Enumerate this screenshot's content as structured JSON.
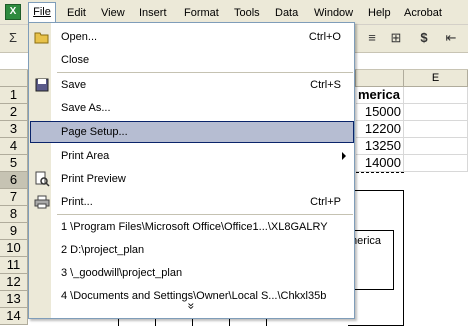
{
  "menubar": {
    "app_icon": "excel-icon",
    "items": [
      {
        "label": "File"
      },
      {
        "label": "Edit"
      },
      {
        "label": "View"
      },
      {
        "label": "Insert"
      },
      {
        "label": "Format"
      },
      {
        "label": "Tools"
      },
      {
        "label": "Data"
      },
      {
        "label": "Window"
      },
      {
        "label": "Help"
      },
      {
        "label": "Acrobat"
      }
    ]
  },
  "toolbar": {
    "sum_glyph": "Σ",
    "align_glyph": "≡",
    "merge_glyph": "⊞",
    "currency_glyph": "$",
    "indent_glyph": "⇤"
  },
  "sheet": {
    "col_e": "E",
    "rows": [
      "1",
      "2",
      "3",
      "4",
      "5",
      "6",
      "7",
      "8",
      "9",
      "10",
      "11",
      "12",
      "13",
      "14"
    ],
    "header_text": "merica",
    "values": [
      "15000",
      "12200",
      "13250",
      "14000"
    ],
    "legend_text": "merica"
  },
  "file_menu": {
    "items": [
      {
        "label": "Open...",
        "shortcut": "Ctrl+O",
        "icon": "open-folder-icon"
      },
      {
        "label": "Close"
      },
      {
        "label": "Save",
        "shortcut": "Ctrl+S",
        "icon": "save-disk-icon"
      },
      {
        "label": "Save As..."
      },
      {
        "label": "Page Setup..."
      },
      {
        "label": "Print Area"
      },
      {
        "label": "Print Preview",
        "icon": "print-preview-icon"
      },
      {
        "label": "Print...",
        "shortcut": "Ctrl+P",
        "icon": "printer-icon"
      },
      {
        "label": "1 \\Program Files\\Microsoft Office\\Office1...\\XL8GALRY"
      },
      {
        "label": "2 D:\\project_plan"
      },
      {
        "label": "3 \\_goodwill\\project_plan"
      },
      {
        "label": "4 \\Documents and Settings\\Owner\\Local S...\\Chkxl35b"
      }
    ],
    "expand_glyph": "»"
  }
}
